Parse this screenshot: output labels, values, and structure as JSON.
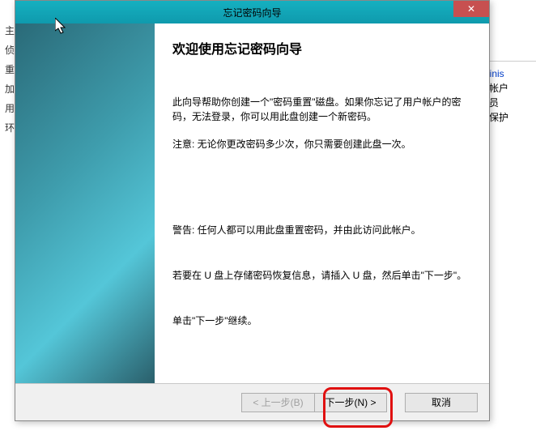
{
  "left_list": {
    "items": [
      "主",
      "侦",
      "重",
      "加",
      "用",
      "环"
    ]
  },
  "right_panel": {
    "admin_label": "Adminis",
    "line1": "本地帐户",
    "line2": "管理员",
    "line3": "密码保护"
  },
  "wizard": {
    "title": "忘记密码向导",
    "close_glyph": "✕",
    "heading": "欢迎使用忘记密码向导",
    "para1": "此向导帮助你创建一个\"密码重置\"磁盘。如果你忘记了用户帐户的密码，无法登录，你可以用此盘创建一个新密码。",
    "para2": "注意: 无论你更改密码多少次，你只需要创建此盘一次。",
    "para3": "警告: 任何人都可以用此盘重置密码，并由此访问此帐户。",
    "para4": "若要在 U 盘上存储密码恢复信息，请插入 U 盘，然后单击\"下一步\"。",
    "para5": "单击\"下一步\"继续。",
    "buttons": {
      "back": "< 上一步(B)",
      "next": "下一步(N) >",
      "cancel": "取消"
    }
  }
}
